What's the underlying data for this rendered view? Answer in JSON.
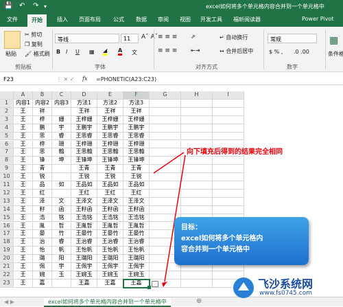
{
  "window": {
    "title": "excel如何将多个单元格内容合并到一个单元格中",
    "quick_access": [
      "save-icon",
      "undo-icon",
      "redo-icon",
      "dropdown-icon"
    ]
  },
  "tabs": [
    "文件",
    "开始",
    "插入",
    "页面布局",
    "公式",
    "数据",
    "审阅",
    "视图",
    "开发工具",
    "福昕阅读器",
    "Power Pivot"
  ],
  "active_tab": "开始",
  "ribbon": {
    "paste": "粘贴",
    "cut": "剪切",
    "copy": "复制",
    "format_painter": "格式刷",
    "clipboard_group": "剪贴板",
    "font_name": "等线",
    "font_size": "11",
    "font_group": "字体",
    "bold": "B",
    "italic": "I",
    "underline": "U",
    "wrap": "自动换行",
    "merge": "合并后居中",
    "align_group": "对齐方式",
    "number_format": "常规",
    "number_group": "数字",
    "cond_format": "条件格式",
    "wen": "文"
  },
  "formula_bar": {
    "name_box": "F23",
    "fx": "fx",
    "formula": "=PHONETIC(A23:C23)"
  },
  "columns": [
    "A",
    "B",
    "C",
    "D",
    "E",
    "F",
    "G",
    "H",
    "I"
  ],
  "selected_column": "F",
  "rows": [
    [
      "内容1",
      "内容2",
      "内容3",
      "方法1",
      "方法2",
      "方法3"
    ],
    [
      "王",
      "祥",
      "",
      "王祥",
      "王祥",
      "王祥"
    ],
    [
      "王",
      "梓",
      "姗",
      "王梓姗",
      "王梓姗",
      "王梓姗"
    ],
    [
      "王",
      "鹏",
      "宇",
      "王鹏宇",
      "王鹏宇",
      "王鹏宇"
    ],
    [
      "王",
      "思",
      "睿",
      "王思睿",
      "王思睿",
      "王思睿"
    ],
    [
      "王",
      "梓",
      "珊",
      "王梓珊",
      "王梓珊",
      "王梓珊"
    ],
    [
      "王",
      "思",
      "翰",
      "王思翰",
      "王思翰",
      "王思翰"
    ],
    [
      "王",
      "锋",
      "坤",
      "王锋坤",
      "王锋坤",
      "王锋坤"
    ],
    [
      "王",
      "青",
      "",
      "王青",
      "王青",
      "王青"
    ],
    [
      "王",
      "锐",
      "",
      "王锐",
      "王锐",
      "王锐"
    ],
    [
      "王",
      "品",
      "如",
      "王品如",
      "王品如",
      "王品如"
    ],
    [
      "王",
      "红",
      "",
      "王红",
      "王红",
      "王红"
    ],
    [
      "王",
      "泽",
      "文",
      "王泽文",
      "王泽文",
      "王泽文"
    ],
    [
      "王",
      "籽",
      "函",
      "王籽函",
      "王籽函",
      "王籽函"
    ],
    [
      "王",
      "浩",
      "铭",
      "王浩铭",
      "王浩铭",
      "王浩铭"
    ],
    [
      "王",
      "胤",
      "哲",
      "王胤哲",
      "王胤哲",
      "王胤哲"
    ],
    [
      "王",
      "晏",
      "竹",
      "王晏竹",
      "王晏竹",
      "王晏竹"
    ],
    [
      "王",
      "治",
      "睿",
      "王治睿",
      "王治睿",
      "王治睿"
    ],
    [
      "王",
      "怡",
      "帆",
      "王怡帆",
      "王怡帆",
      "王怡帆"
    ],
    [
      "王",
      "璐",
      "阳",
      "王璐阳",
      "王璐阳",
      "王璐阳"
    ],
    [
      "王",
      "佩",
      "宇",
      "王佩宇",
      "王佩宇",
      "王佩宇"
    ],
    [
      "王",
      "婉",
      "玉",
      "王婉玉",
      "王婉玉",
      "王婉玉"
    ],
    [
      "王",
      "嘉",
      "",
      "王嘉",
      "王嘉",
      "王嘉"
    ]
  ],
  "annotation": {
    "callout": "向下填充后得到的结果完全相同",
    "target_lines": [
      "目标：",
      "excel如何将多个单元格内",
      "容合并到一个单元格中"
    ]
  },
  "sheet_tab": "excel如何将多个单元格内容合并到一个单元格中",
  "watermark": {
    "name": "飞沙系统网",
    "url": "www.fs0745.com"
  },
  "colors": {
    "excel_green": "#217346",
    "callout_red": "#e8000a",
    "target_blue": "#1f6fd0"
  }
}
